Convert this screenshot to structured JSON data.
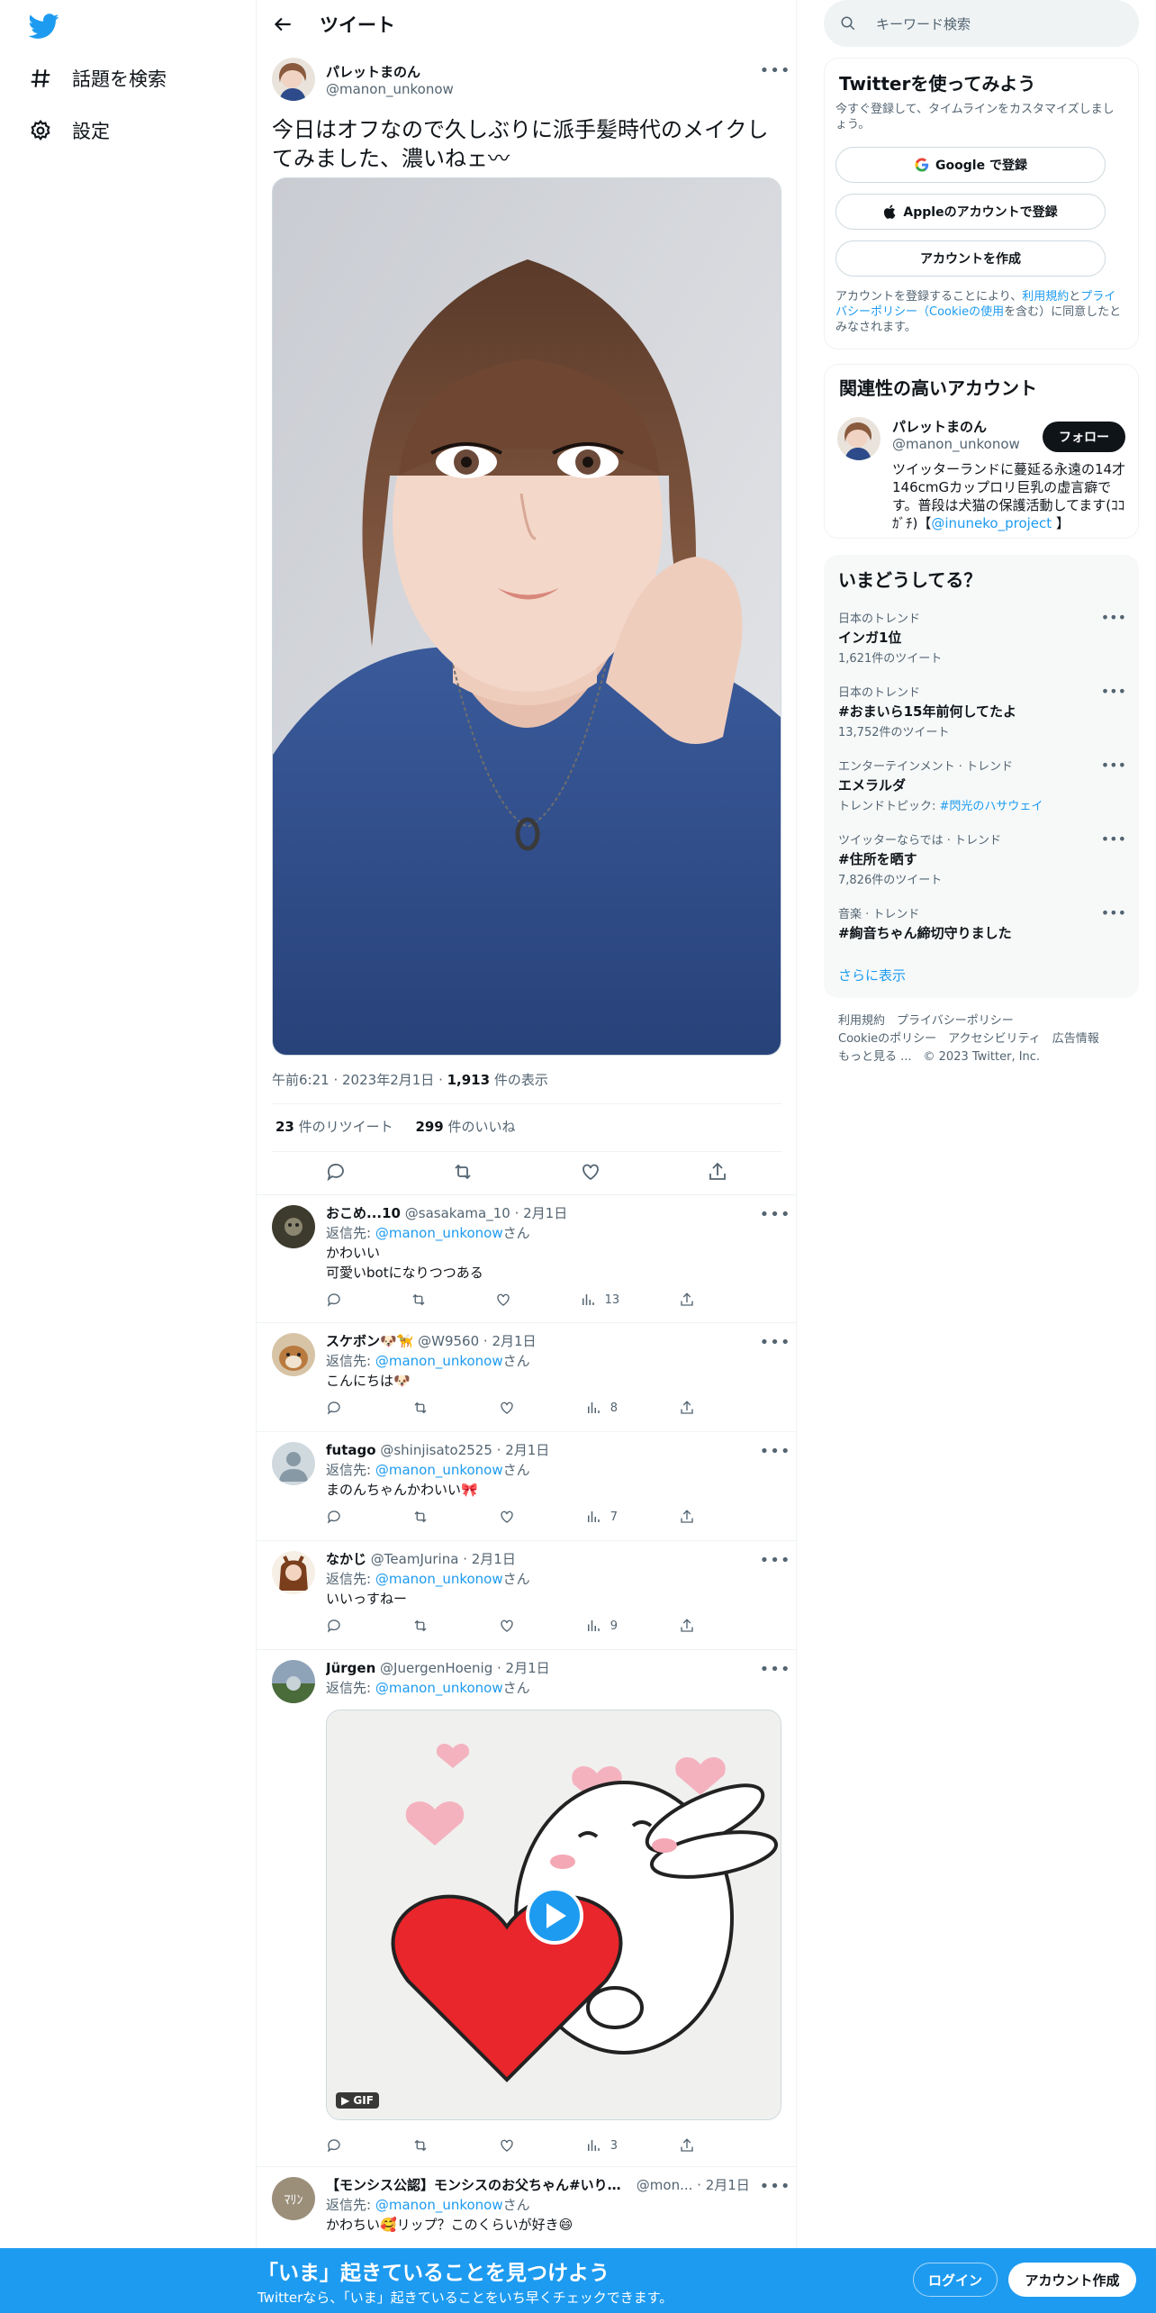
{
  "nav": {
    "explore_label": "話題を検索",
    "settings_label": "設定"
  },
  "header": {
    "title": "ツイート"
  },
  "tweet": {
    "author_name": "パレットまのん",
    "author_handle": "@manon_unkonow",
    "text": "今日はオフなので久しぶりに派手髪時代のメイクしてみました、濃いねェ〰",
    "time": "午前6:21",
    "date": "2023年2月1日",
    "views_count": "1,913",
    "views_label": " 件の表示",
    "retweets_count": "23",
    "retweets_label": " 件のリツイート",
    "likes_count": "299",
    "likes_label": " 件のいいね"
  },
  "replies": [
    {
      "name": "おこめ...10",
      "handle": "@sasakama_10",
      "date": "2月1日",
      "reply_to_prefix": "返信先: ",
      "reply_to": "@manon_unkonow",
      "reply_to_suffix": "さん",
      "text_lines": [
        "かわいい",
        "可愛いbotになりつつある"
      ],
      "views": "13"
    },
    {
      "name": "スケボン🐶🦮",
      "handle": "@W9560",
      "date": "2月1日",
      "reply_to_prefix": "返信先: ",
      "reply_to": "@manon_unkonow",
      "reply_to_suffix": "さん",
      "text_lines": [
        "こんにちは🐶"
      ],
      "views": "8"
    },
    {
      "name": "futago",
      "handle": "@shinjisato2525",
      "date": "2月1日",
      "reply_to_prefix": "返信先: ",
      "reply_to": "@manon_unkonow",
      "reply_to_suffix": "さん",
      "text_lines": [
        "まのんちゃんかわいい🎀"
      ],
      "views": "7"
    },
    {
      "name": "なかじ",
      "handle": "@TeamJurina",
      "date": "2月1日",
      "reply_to_prefix": "返信先: ",
      "reply_to": "@manon_unkonow",
      "reply_to_suffix": "さん",
      "text_lines": [
        "いいっすねー"
      ],
      "views": "9"
    },
    {
      "name": "Jürgen",
      "handle": "@JuergenHoenig",
      "date": "2月1日",
      "reply_to_prefix": "返信先: ",
      "reply_to": "@manon_unkonow",
      "reply_to_suffix": "さん",
      "text_lines": [],
      "views": "3",
      "gif_label": "GIF"
    },
    {
      "name": "【モンシス公認】モンシスのお父ちゃん#いりこ...",
      "handle": "@mon...",
      "date": "2月1日",
      "reply_to_prefix": "返信先: ",
      "reply_to": "@manon_unkonow",
      "reply_to_suffix": "さん",
      "text_lines": [
        "かわちい🥰リップ？このくらいが好き😄"
      ],
      "views": ""
    }
  ],
  "search": {
    "placeholder": "キーワード検索"
  },
  "signup_box": {
    "title": "Twitterを使ってみよう",
    "subtitle": "今すぐ登録して、タイムラインをカスタマイズしましょう。",
    "google": "Google で登録",
    "apple": "Appleのアカウントで登録",
    "create": "アカウントを作成",
    "terms_1": "アカウントを登録することにより、",
    "terms_link1": "利用規約",
    "terms_2": "と",
    "terms_link2": "プライバシーポリシー（Cookieの使用",
    "terms_3": "を含む）に同意したとみなされます。"
  },
  "related": {
    "title": "関連性の高いアカウント",
    "name": "パレットまのん",
    "handle": "@manon_unkonow",
    "follow": "フォロー",
    "bio": "ツイッターランドに蔓延る永遠の14才146cmGカップロリ巨乳の虚言癖です。普段は犬猫の保護活動してます(ｺｺｶﾞﾁ)【",
    "bio_link": "@inuneko_project",
    "bio_end": " 】"
  },
  "trends": {
    "title": "いまどうしてる？",
    "items": [
      {
        "context": "日本のトレンド",
        "name": "インガ1位",
        "count": "1,621件のツイート"
      },
      {
        "context": "日本のトレンド",
        "name": "#おまいら15年前何してたよ",
        "count": "13,752件のツイート"
      },
      {
        "context": "エンターテインメント · トレンド",
        "name": "エメラルダ",
        "count_prefix": "トレンドトピック: ",
        "count_link": "#閃光のハサウェイ"
      },
      {
        "context": "ツイッターならでは · トレンド",
        "name": "#住所を晒す",
        "count": "7,826件のツイート"
      },
      {
        "context": "音楽 · トレンド",
        "name": "#絢音ちゃん締切守りました",
        "count": ""
      }
    ],
    "show_more": "さらに表示"
  },
  "footer": {
    "line1": "利用規約　プライバシーポリシー",
    "line2": "Cookieのポリシー　アクセシビリティ　広告情報",
    "line3": "もっと見る ...　© 2023 Twitter, Inc."
  },
  "banner": {
    "headline": "「いま」起きていることを見つけよう",
    "sub": "Twitterなら、「いま」起きていることをいち早くチェックできます。",
    "login": "ログイン",
    "signup": "アカウント作成"
  },
  "colors": {
    "accent": "#1d9bf0",
    "text": "#0f1419",
    "muted": "#536471"
  }
}
